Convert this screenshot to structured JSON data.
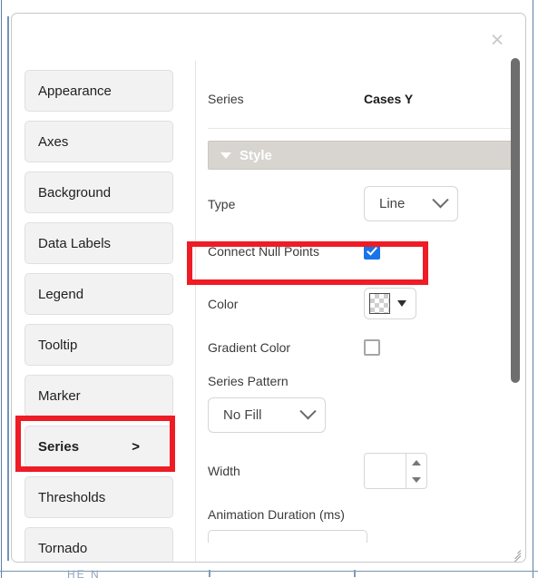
{
  "dialog": {
    "close_label": "×"
  },
  "sidebar": {
    "items": [
      {
        "label": "Appearance",
        "chevron": ""
      },
      {
        "label": "Axes",
        "chevron": ""
      },
      {
        "label": "Background",
        "chevron": ""
      },
      {
        "label": "Data Labels",
        "chevron": ""
      },
      {
        "label": "Legend",
        "chevron": ""
      },
      {
        "label": "Tooltip",
        "chevron": ""
      },
      {
        "label": "Marker",
        "chevron": ""
      },
      {
        "label": "Series",
        "chevron": ">"
      },
      {
        "label": "Thresholds",
        "chevron": ""
      },
      {
        "label": "Tornado",
        "chevron": ""
      }
    ]
  },
  "panel": {
    "header": {
      "label": "Series",
      "value": "Cases Y"
    },
    "section": {
      "title": "Style",
      "expanded": true
    },
    "fields": {
      "type": {
        "label": "Type",
        "value": "Line"
      },
      "connect_null_points": {
        "label": "Connect Null Points",
        "checked": true
      },
      "color": {
        "label": "Color",
        "value": "transparent"
      },
      "gradient_color": {
        "label": "Gradient Color",
        "checked": false
      },
      "series_pattern": {
        "label": "Series Pattern",
        "value": "No Fill"
      },
      "width": {
        "label": "Width",
        "value": "",
        "placeholder": ""
      },
      "animation_duration": {
        "label": "Animation Duration (ms)",
        "value": ""
      }
    }
  },
  "annotations": {
    "highlight_color": "#ee1c25",
    "boxes": [
      {
        "target": "Connect Null Points"
      },
      {
        "target": "Series"
      }
    ]
  },
  "background": {
    "ghost_text": "HE         N"
  },
  "colors": {
    "accent_blue": "#1a73e8",
    "sidebar_button": "#f2f2f2",
    "style_bar": "#d8d4d0",
    "scrollbar_thumb": "#6e6e6e"
  }
}
